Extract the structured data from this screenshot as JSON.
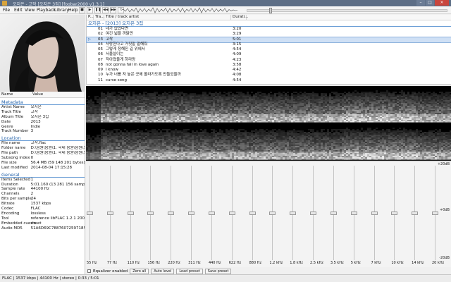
{
  "window": {
    "title": "오지은 - 고작 [오지은 3집] [foobar2000 v1.3.1]"
  },
  "menu": [
    "File",
    "Edit",
    "View",
    "Playback",
    "Library",
    "Help"
  ],
  "toolbar": [
    "■",
    "▶",
    "❚❚",
    "◀◀",
    "▶▶",
    "?"
  ],
  "properties": {
    "col_name": "Name",
    "col_value": "Value",
    "sections": [
      {
        "title": "Metadata",
        "rows": [
          [
            "Artist Name",
            "오지은"
          ],
          [
            "Track Title",
            "고작"
          ],
          [
            "Album Title",
            "오지은 3집"
          ],
          [
            "Date",
            "2013"
          ],
          [
            "Genre",
            "Indie"
          ],
          [
            "Track Number",
            "3"
          ]
        ]
      },
      {
        "title": "Location",
        "rows": [
          [
            "File name",
            "고작.flac"
          ],
          [
            "Folder name",
            "D:\\음원\\음원\\1. 국내  음원\\음원\\오지은 3집"
          ],
          [
            "File path",
            "D:\\음원\\음원\\1. 국내  음원\\음원\\오지은 3집\\고작.flac"
          ],
          [
            "Subsong index",
            "0"
          ],
          [
            "File size",
            "56.4 MB (59 148 201 bytes)"
          ],
          [
            "Last modified",
            "2014-08-04 17:15:28"
          ]
        ]
      },
      {
        "title": "General",
        "rows": [
          [
            "Items Selected",
            "1"
          ],
          [
            "Duration",
            "5:01.160 (13 281 156 samples)"
          ],
          [
            "Sample rate",
            "44100 Hz"
          ],
          [
            "Channels",
            "2"
          ],
          [
            "Bits per sample",
            "24"
          ],
          [
            "Bitrate",
            "1537 kbps"
          ],
          [
            "Codec",
            "FLAC"
          ],
          [
            "Encoding",
            "lossless"
          ],
          [
            "Tool",
            "reference libFLAC 1.2.1 20070917"
          ],
          [
            "Embedded cuesheet",
            "no"
          ],
          [
            "Audio MD5",
            "51A6D69C78876072597185 56FC0"
          ]
        ]
      }
    ]
  },
  "playlist": {
    "columns": [
      "P...",
      "Tra...",
      "Title / track artist",
      "Durati..."
    ],
    "group": "오지은 - [2013] 오지은 3집",
    "tracks": [
      {
        "no": "01",
        "title": "네가 없었다면",
        "dur": "3:20",
        "playing": false
      },
      {
        "no": "02",
        "title": "여긴 넓을 까닭만",
        "dur": "3:29",
        "playing": false
      },
      {
        "no": "03",
        "title": "고작",
        "dur": "5:01",
        "playing": true
      },
      {
        "no": "04",
        "title": "사랑한다고 거짓말 말해줘",
        "dur": "3:15",
        "playing": false
      },
      {
        "no": "05",
        "title": "그렇게 정해진 길 위에서",
        "dur": "4:54",
        "playing": false
      },
      {
        "no": "06",
        "title": "서울살이는",
        "dur": "4:09",
        "playing": false
      },
      {
        "no": "07",
        "title": "작아졌을게 하라랑",
        "dur": "4:23",
        "playing": false
      },
      {
        "no": "08",
        "title": "not gonna fall in love again",
        "dur": "3:58",
        "playing": false
      },
      {
        "no": "09",
        "title": "I know",
        "dur": "4:42",
        "playing": false
      },
      {
        "no": "10",
        "title": "누가 너를 저 높은 곳에 올라가도록 만들었을까",
        "dur": "4:08",
        "playing": false
      },
      {
        "no": "11",
        "title": "curse song",
        "dur": "4:54",
        "playing": false
      }
    ]
  },
  "equalizer": {
    "scale": [
      "+20dB",
      "+0dB",
      "-20dB"
    ],
    "bands": [
      {
        "freq": "55 Hz",
        "gain": 0
      },
      {
        "freq": "77 Hz",
        "gain": 0
      },
      {
        "freq": "110 Hz",
        "gain": 0
      },
      {
        "freq": "156 Hz",
        "gain": 0
      },
      {
        "freq": "220 Hz",
        "gain": 0
      },
      {
        "freq": "311 Hz",
        "gain": 0
      },
      {
        "freq": "440 Hz",
        "gain": 0
      },
      {
        "freq": "622 Hz",
        "gain": 0
      },
      {
        "freq": "880 Hz",
        "gain": 0
      },
      {
        "freq": "1.2 kHz",
        "gain": 0
      },
      {
        "freq": "1.8 kHz",
        "gain": 0
      },
      {
        "freq": "2.5 kHz",
        "gain": 0
      },
      {
        "freq": "3.5 kHz",
        "gain": 0
      },
      {
        "freq": "5 kHz",
        "gain": 0
      },
      {
        "freq": "7 kHz",
        "gain": 0
      },
      {
        "freq": "10 kHz",
        "gain": 0
      },
      {
        "freq": "14 kHz",
        "gain": 0
      },
      {
        "freq": "20 kHz",
        "gain": 0
      }
    ],
    "enabled_label": "Equalizer enabled",
    "buttons": [
      "Zero all",
      "Auto level",
      "Load preset",
      "Save preset"
    ]
  },
  "status": "FLAC | 1537 kbps | 44100 Hz | stereo | 0:33 / 5:01",
  "seek_fraction": 0.11
}
